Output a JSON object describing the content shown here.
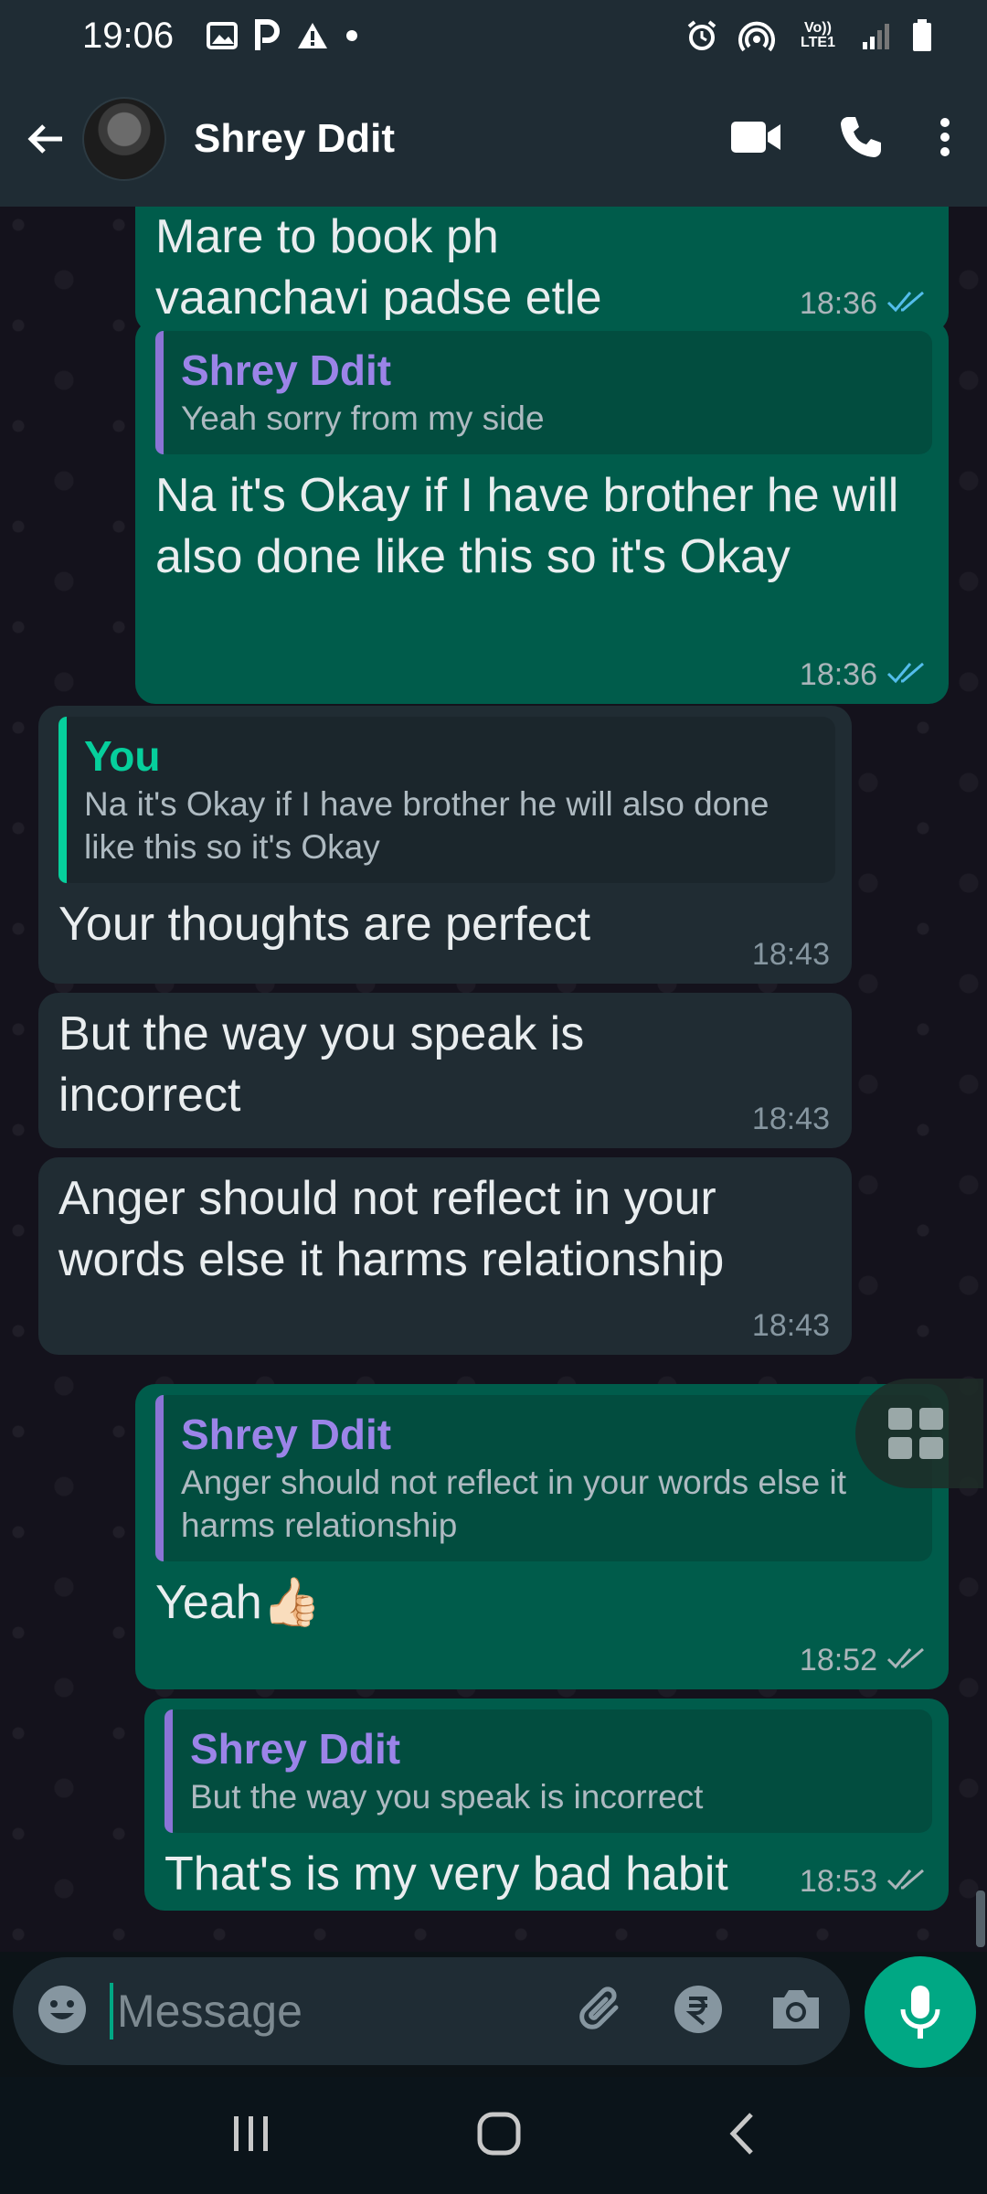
{
  "status_bar": {
    "time": "19:06",
    "network": "Vo)) LTE1"
  },
  "header": {
    "contact_name": "Shrey Ddit"
  },
  "messages": [
    {
      "direction": "out",
      "text": "Mare to book ph vaanchavi padse etle",
      "time": "18:36",
      "status": "read"
    },
    {
      "direction": "out",
      "quote_author": "Shrey Ddit",
      "quote_text": "Yeah sorry from my side",
      "text": "Na it's Okay if I have brother he will also done like this so it's Okay",
      "time": "18:36",
      "status": "read"
    },
    {
      "direction": "in",
      "quote_author": "You",
      "quote_text": "Na it's Okay if I have brother he will also done like this so it's Okay",
      "text": "Your thoughts are perfect",
      "time": "18:43"
    },
    {
      "direction": "in",
      "text": "But the way you speak is incorrect",
      "time": "18:43"
    },
    {
      "direction": "in",
      "text": "Anger should not reflect in your words else it harms relationship",
      "time": "18:43"
    },
    {
      "direction": "out",
      "quote_author": "Shrey Ddit",
      "quote_text": "Anger should not reflect in your words else it harms relationship",
      "text": "Yeah👍🏻",
      "time": "18:52",
      "status": "delivered"
    },
    {
      "direction": "out",
      "quote_author": "Shrey Ddit",
      "quote_text": "But the way you speak is incorrect",
      "text": "That's is my very bad habit",
      "time": "18:53",
      "status": "delivered"
    }
  ],
  "input": {
    "placeholder": "Message"
  },
  "colors": {
    "outgoing_bubble": "#005c4b",
    "incoming_bubble": "#202c33",
    "accent": "#00a884",
    "read_tick": "#53bdeb",
    "quote_purple": "#9b84e8",
    "quote_green": "#06cf9c"
  },
  "icons": {
    "status_left": [
      "gallery-icon",
      "parking-icon",
      "warning-icon",
      "dot-icon"
    ],
    "status_right": [
      "alarm-icon",
      "hotspot-icon",
      "signal-icon",
      "battery-icon"
    ],
    "header": [
      "back-arrow-icon",
      "video-call-icon",
      "phone-icon",
      "more-options-icon"
    ],
    "input": [
      "emoji-icon",
      "attach-icon",
      "rupee-payment-icon",
      "camera-icon",
      "mic-icon"
    ],
    "nav": [
      "recent-apps-icon",
      "home-icon",
      "back-icon"
    ]
  }
}
